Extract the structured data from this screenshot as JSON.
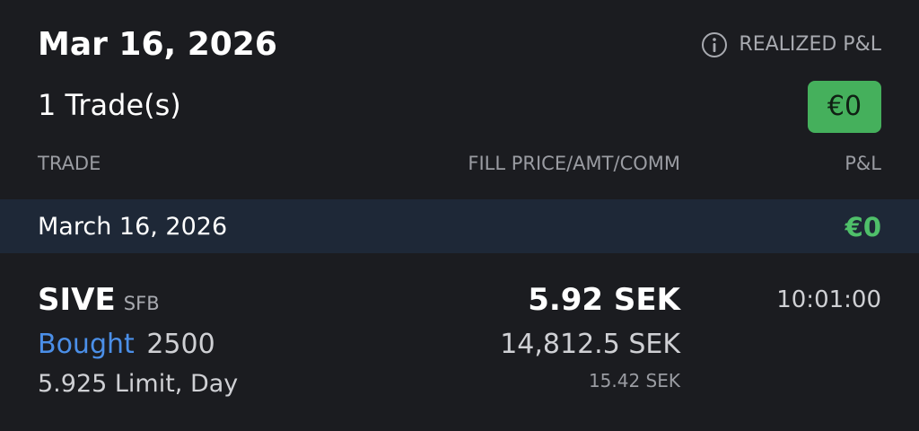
{
  "summary": {
    "date": "Mar 16, 2026",
    "trade_count": "1 Trade(s)",
    "realized_label": "REALIZED P&L",
    "realized_value": "€0",
    "info_icon": "info-circle-icon",
    "badge_color": "#45b05c"
  },
  "columns": {
    "trade": "TRADE",
    "fill": "FILL PRICE/AMT/COMM",
    "pnl": "P&L"
  },
  "day_group": {
    "label": "March 16, 2026",
    "pnl": "€0",
    "pnl_color": "#4fc06a"
  },
  "trades": [
    {
      "symbol": "SIVE",
      "exchange": "SFB",
      "action": "Bought",
      "quantity": "2500",
      "order_details": "5.925 Limit, Day",
      "fill_price": "5.92 SEK",
      "amount": "14,812.5 SEK",
      "commission": "15.42 SEK",
      "time": "10:01:00"
    }
  ],
  "colors": {
    "background": "#1b1c20",
    "row_highlight": "#1e2837",
    "action_blue": "#4b8fe8"
  }
}
